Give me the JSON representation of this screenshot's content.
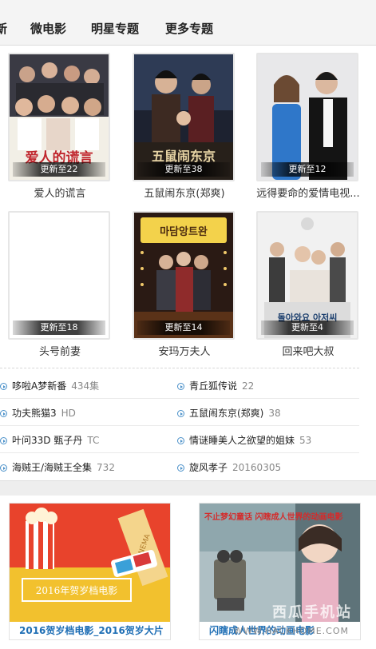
{
  "tabs": [
    "新",
    "微电影",
    "明星专题",
    "更多专题"
  ],
  "posters": [
    {
      "title": "爱人的谎言",
      "update": "更新至22",
      "poster_text": "爱人的谎言"
    },
    {
      "title": "五鼠闹东京(郑爽)",
      "update": "更新至38",
      "poster_text": "五鼠闹东京"
    },
    {
      "title": "远得要命的爱情电视...",
      "update": "更新至12",
      "poster_text": ""
    },
    {
      "title": "头号前妻",
      "update": "更新至18",
      "poster_text": ""
    },
    {
      "title": "安玛万夫人",
      "update": "更新至14",
      "poster_text": "마담앙트완"
    },
    {
      "title": "回来吧大叔",
      "update": "更新至4",
      "poster_text": "돌아와요 아저씨"
    }
  ],
  "list": [
    {
      "title": "哆啦A梦新番",
      "meta": "434集"
    },
    {
      "title": "青丘狐传说",
      "meta": "22"
    },
    {
      "title": "功夫熊猫3",
      "meta": "HD"
    },
    {
      "title": "五鼠闹东京(郑爽)",
      "meta": "38"
    },
    {
      "title": "叶问33D 甄子丹",
      "meta": "TC"
    },
    {
      "title": "情谜睡美人之欲望的姐妹",
      "meta": "53"
    },
    {
      "title": "海贼王/海贼王全集",
      "meta": "732"
    },
    {
      "title": "旋风孝子",
      "meta": "20160305"
    }
  ],
  "features": [
    {
      "caption": "2016贺岁档电影_2016贺岁大片",
      "banner_text": "2016年贺岁档电影",
      "side_text": "CINEMA"
    },
    {
      "caption": "闪瞎成人世界的动画电影",
      "banner_text": "不止梦幻童话 闪瞎成人世界的动画电影"
    }
  ],
  "watermark": {
    "text": "西瓜手机站",
    "url": "WWW.HACKHOME.COM"
  },
  "colors": {
    "link_blue": "#1f6fb5",
    "icon_blue": "#4a90c9",
    "banner_red": "#e8432c",
    "banner_yellow": "#f2c12e"
  }
}
